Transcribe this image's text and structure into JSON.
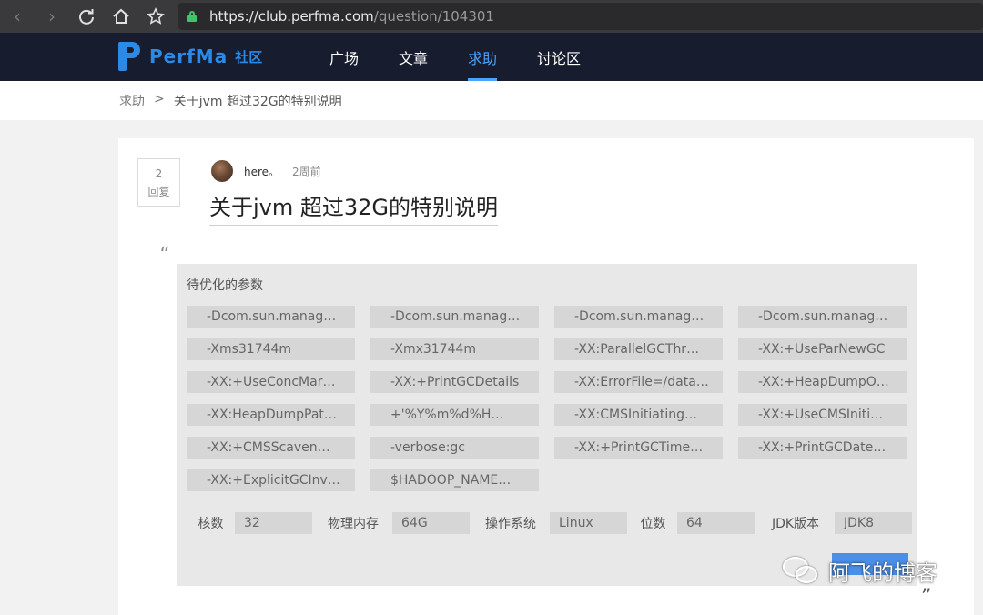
{
  "browser": {
    "url_host": "https://club.perfma.com",
    "url_path": "/question/104301",
    "back_icon": "chevron-left",
    "forward_icon": "chevron-right",
    "reload_icon": "reload",
    "home_icon": "home",
    "bookmark_icon": "star"
  },
  "header": {
    "logo_text": "PerfMa",
    "logo_sub": "社区",
    "nav": [
      "广场",
      "文章",
      "求助",
      "讨论区"
    ],
    "active_nav": "求助",
    "accent_color": "#4aa3ff",
    "brand_color": "#2b8ae6",
    "background": "#171c2e"
  },
  "breadcrumb": {
    "parent": "求助",
    "separator": ">",
    "current": "关于jvm 超过32G的特别说明"
  },
  "post": {
    "reply_count": "2",
    "reply_label": "回复",
    "author": "here。",
    "time": "2周前",
    "title": "关于jvm 超过32G的特别说明",
    "open_quote": "“",
    "close_quote": "”",
    "params_heading": "待优化的参数",
    "params": [
      "-Dcom.sun.manag…",
      "-Dcom.sun.manag…",
      "-Dcom.sun.manag…",
      "-Dcom.sun.manag…",
      "-Xms31744m",
      "-Xmx31744m",
      "-XX:ParallelGCThr…",
      "-XX:+UseParNewGC",
      "-XX:+UseConcMar…",
      "-XX:+PrintGCDetails",
      "-XX:ErrorFile=/data…",
      "-XX:+HeapDumpO…",
      "-XX:HeapDumpPat…",
      "+'%Y%m%d%H…",
      "-XX:CMSInitiating…",
      "-XX:+UseCMSIniti…",
      "-XX:+CMSScaven…",
      "-verbose:gc",
      "-XX:+PrintGCTime…",
      "-XX:+PrintGCDate…",
      "-XX:+ExplicitGCInv…",
      "$HADOOP_NAME…"
    ],
    "specs": [
      {
        "label": "核数",
        "value": "32"
      },
      {
        "label": "物理内存",
        "value": "64G"
      },
      {
        "label": "操作系统",
        "value": "Linux"
      },
      {
        "label": "位数",
        "value": "64"
      },
      {
        "label": "JDK版本",
        "value": "JDK8"
      }
    ]
  },
  "watermark": {
    "text": "阿飞的博客"
  }
}
